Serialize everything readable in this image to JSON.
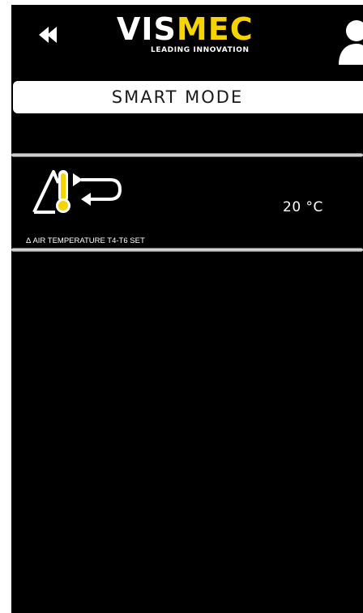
{
  "header": {
    "back_icon": "double-chevron-left-icon",
    "logo": {
      "word_white": "VIS",
      "word_yellow": "MEC",
      "tagline": "LEADING INNOVATION"
    },
    "user_icon": "user-icon"
  },
  "mode": {
    "title": "SMART MODE"
  },
  "parameters": [
    {
      "icon": "delta-temperature-return-icon",
      "value": "20 °C",
      "label": "Δ AIR TEMPERATURE T4-T6 SET"
    }
  ],
  "colors": {
    "background": "#000000",
    "accent_yellow": "#f6d400",
    "text": "#ffffff"
  }
}
